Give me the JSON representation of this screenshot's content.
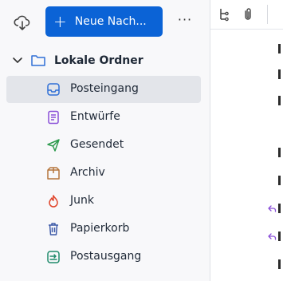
{
  "toolbar": {
    "new_message_label": "Neue Nach...",
    "new_message_plus": "+",
    "more_label": "···"
  },
  "account": {
    "name": "Lokale Ordner"
  },
  "folders": [
    {
      "label": "Posteingang",
      "icon": "inbox-icon",
      "selected": true
    },
    {
      "label": "Entwürfe",
      "icon": "drafts-icon",
      "selected": false
    },
    {
      "label": "Gesendet",
      "icon": "sent-icon",
      "selected": false
    },
    {
      "label": "Archiv",
      "icon": "archive-icon",
      "selected": false
    },
    {
      "label": "Junk",
      "icon": "junk-icon",
      "selected": false
    },
    {
      "label": "Papierkorb",
      "icon": "trash-icon",
      "selected": false
    },
    {
      "label": "Postausgang",
      "icon": "outbox-icon",
      "selected": false
    }
  ],
  "colors": {
    "accent": "#0b63d6",
    "inbox": "#2f6fd6",
    "drafts": "#8a4fd8",
    "sent": "#2e9b4e",
    "archive": "#b6763c",
    "junk": "#e0452b",
    "trash": "#3d5aa8",
    "outbox": "#1f8a6b"
  }
}
